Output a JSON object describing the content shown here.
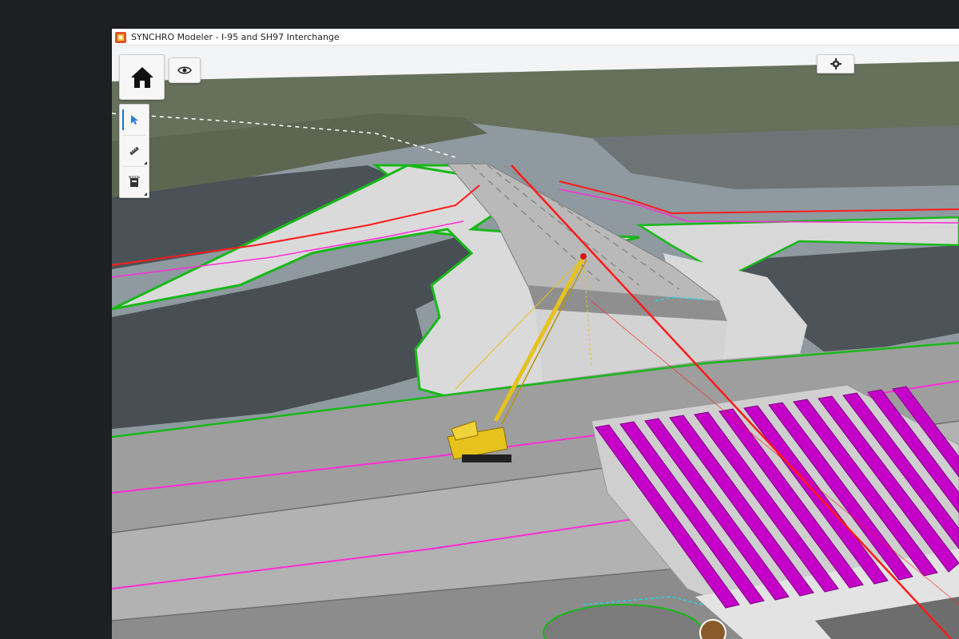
{
  "window": {
    "title": "SYNCHRO Modeler - I-95 and SH97 Interchange",
    "app_icon": "synchro-app-icon"
  },
  "toolbar": {
    "home_icon": "home-icon",
    "visibility_icon": "eye-icon",
    "settings_icon": "gear-icon",
    "tools": [
      {
        "icon": "cursor-arrow-icon",
        "active": true
      },
      {
        "icon": "measure-tape-icon",
        "active": false
      },
      {
        "icon": "section-box-icon",
        "active": false
      }
    ]
  },
  "colors": {
    "selection_accent": "#1d6fd6",
    "cursor_arrow": "#2a7de1",
    "girders": "#c400c8",
    "crane": "#e6c21c",
    "alignment_line": "#ff1a1a",
    "boundary_line": "#18b818",
    "lane_marking": "#ff2bd6",
    "terrain_cut": "#d4d4d4",
    "pavement": "#9a9a9a",
    "water": "#4a5258"
  }
}
